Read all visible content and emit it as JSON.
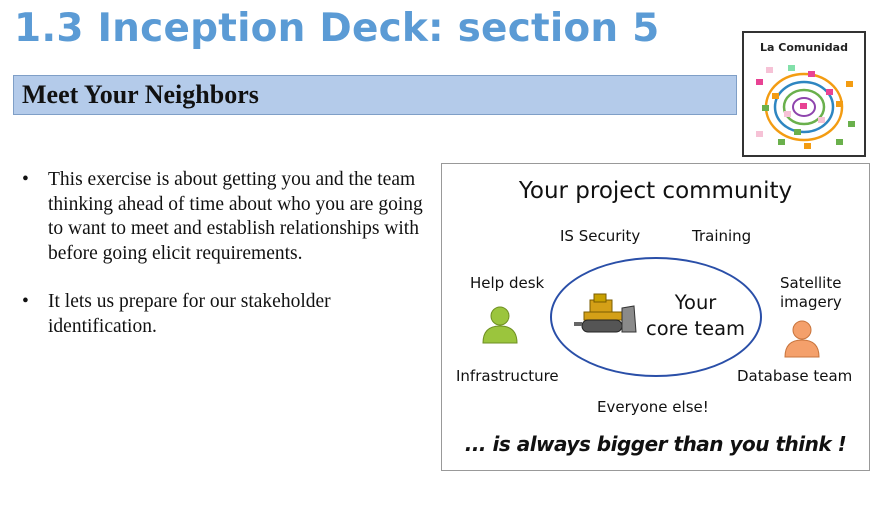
{
  "slide": {
    "title": "1.3 Inception Deck: section 5",
    "subtitle": "Meet Your Neighbors"
  },
  "logo": {
    "label": "La Comunidad"
  },
  "bullets": [
    "This exercise is about getting you and the team thinking ahead of time about who you are going to want to meet and establish relationships with before going elicit requirements.",
    "It lets us prepare for our stakeholder identification."
  ],
  "bullet_marker": "•",
  "diagram": {
    "heading": "Your project community",
    "labels": {
      "is_security": "IS Security",
      "training": "Training",
      "help_desk": "Help desk",
      "satellite_line1": "Satellite",
      "satellite_line2": "imagery",
      "infrastructure": "Infrastructure",
      "database_team": "Database team",
      "everyone_else": "Everyone else!"
    },
    "core_line1": "Your",
    "core_line2": "core team",
    "tagline": "... is always bigger than you think !",
    "person_colors": {
      "left": "#9bc53d",
      "right": "#f4a06b"
    },
    "ellipse_color": "#2a4fa8"
  },
  "colors": {
    "title": "#5b9bd5",
    "subtitle_bar": "#b4cbea"
  }
}
